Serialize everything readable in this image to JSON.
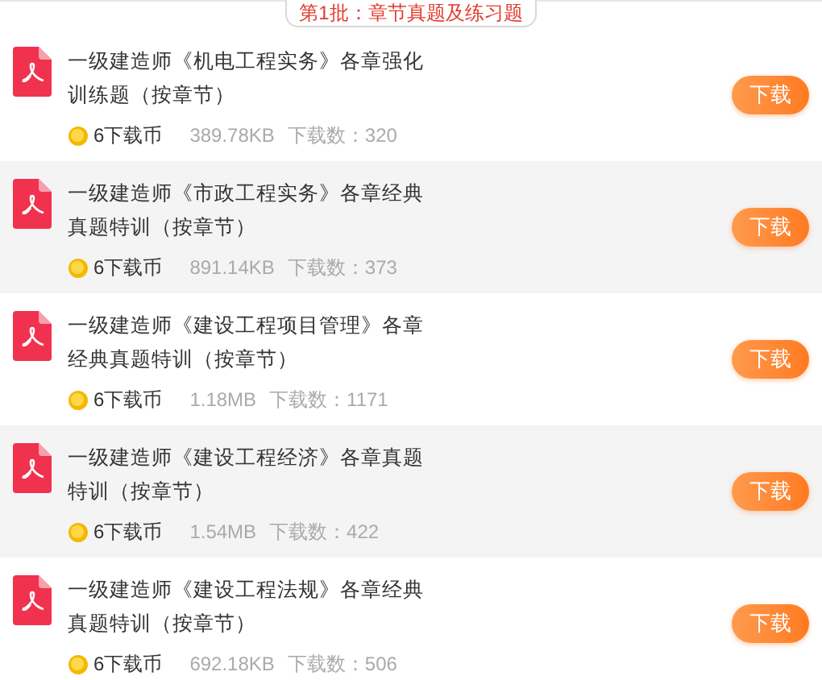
{
  "section_label": "第1批：章节真题及练习题",
  "files": [
    {
      "title": "一级建造师《机电工程实务》各章强化训练题（按章节）",
      "price": "6下载币",
      "size": "389.78KB",
      "downloads": "下载数：320",
      "button": "下载"
    },
    {
      "title": "一级建造师《市政工程实务》各章经典真题特训（按章节）",
      "price": "6下载币",
      "size": "891.14KB",
      "downloads": "下载数：373",
      "button": "下载"
    },
    {
      "title": "一级建造师《建设工程项目管理》各章经典真题特训（按章节）",
      "price": "6下载币",
      "size": "1.18MB",
      "downloads": "下载数：1171",
      "button": "下载"
    },
    {
      "title": "一级建造师《建设工程经济》各章真题特训（按章节）",
      "price": "6下载币",
      "size": "1.54MB",
      "downloads": "下载数：422",
      "button": "下载"
    },
    {
      "title": "一级建造师《建设工程法规》各章经典真题特训（按章节）",
      "price": "6下载币",
      "size": "692.18KB",
      "downloads": "下载数：506",
      "button": "下载"
    }
  ]
}
